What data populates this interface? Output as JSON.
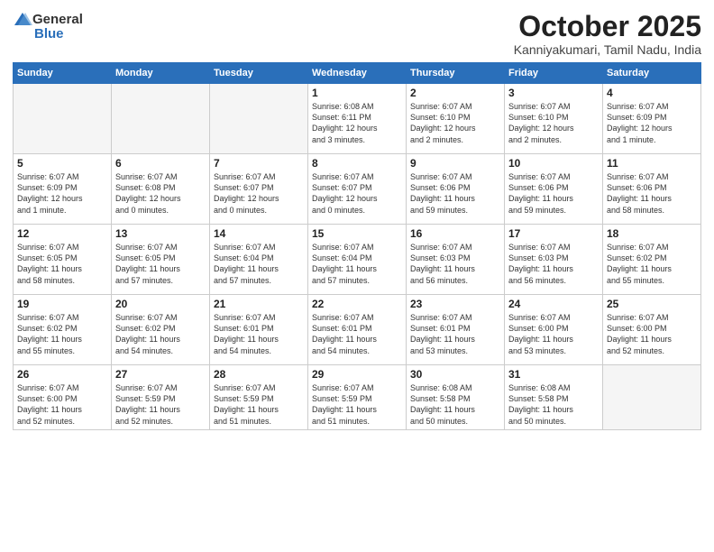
{
  "logo": {
    "general": "General",
    "blue": "Blue"
  },
  "title": "October 2025",
  "location": "Kanniyakumari, Tamil Nadu, India",
  "headers": [
    "Sunday",
    "Monday",
    "Tuesday",
    "Wednesday",
    "Thursday",
    "Friday",
    "Saturday"
  ],
  "weeks": [
    [
      {
        "day": "",
        "info": ""
      },
      {
        "day": "",
        "info": ""
      },
      {
        "day": "",
        "info": ""
      },
      {
        "day": "1",
        "info": "Sunrise: 6:08 AM\nSunset: 6:11 PM\nDaylight: 12 hours\nand 3 minutes."
      },
      {
        "day": "2",
        "info": "Sunrise: 6:07 AM\nSunset: 6:10 PM\nDaylight: 12 hours\nand 2 minutes."
      },
      {
        "day": "3",
        "info": "Sunrise: 6:07 AM\nSunset: 6:10 PM\nDaylight: 12 hours\nand 2 minutes."
      },
      {
        "day": "4",
        "info": "Sunrise: 6:07 AM\nSunset: 6:09 PM\nDaylight: 12 hours\nand 1 minute."
      }
    ],
    [
      {
        "day": "5",
        "info": "Sunrise: 6:07 AM\nSunset: 6:09 PM\nDaylight: 12 hours\nand 1 minute."
      },
      {
        "day": "6",
        "info": "Sunrise: 6:07 AM\nSunset: 6:08 PM\nDaylight: 12 hours\nand 0 minutes."
      },
      {
        "day": "7",
        "info": "Sunrise: 6:07 AM\nSunset: 6:07 PM\nDaylight: 12 hours\nand 0 minutes."
      },
      {
        "day": "8",
        "info": "Sunrise: 6:07 AM\nSunset: 6:07 PM\nDaylight: 12 hours\nand 0 minutes."
      },
      {
        "day": "9",
        "info": "Sunrise: 6:07 AM\nSunset: 6:06 PM\nDaylight: 11 hours\nand 59 minutes."
      },
      {
        "day": "10",
        "info": "Sunrise: 6:07 AM\nSunset: 6:06 PM\nDaylight: 11 hours\nand 59 minutes."
      },
      {
        "day": "11",
        "info": "Sunrise: 6:07 AM\nSunset: 6:06 PM\nDaylight: 11 hours\nand 58 minutes."
      }
    ],
    [
      {
        "day": "12",
        "info": "Sunrise: 6:07 AM\nSunset: 6:05 PM\nDaylight: 11 hours\nand 58 minutes."
      },
      {
        "day": "13",
        "info": "Sunrise: 6:07 AM\nSunset: 6:05 PM\nDaylight: 11 hours\nand 57 minutes."
      },
      {
        "day": "14",
        "info": "Sunrise: 6:07 AM\nSunset: 6:04 PM\nDaylight: 11 hours\nand 57 minutes."
      },
      {
        "day": "15",
        "info": "Sunrise: 6:07 AM\nSunset: 6:04 PM\nDaylight: 11 hours\nand 57 minutes."
      },
      {
        "day": "16",
        "info": "Sunrise: 6:07 AM\nSunset: 6:03 PM\nDaylight: 11 hours\nand 56 minutes."
      },
      {
        "day": "17",
        "info": "Sunrise: 6:07 AM\nSunset: 6:03 PM\nDaylight: 11 hours\nand 56 minutes."
      },
      {
        "day": "18",
        "info": "Sunrise: 6:07 AM\nSunset: 6:02 PM\nDaylight: 11 hours\nand 55 minutes."
      }
    ],
    [
      {
        "day": "19",
        "info": "Sunrise: 6:07 AM\nSunset: 6:02 PM\nDaylight: 11 hours\nand 55 minutes."
      },
      {
        "day": "20",
        "info": "Sunrise: 6:07 AM\nSunset: 6:02 PM\nDaylight: 11 hours\nand 54 minutes."
      },
      {
        "day": "21",
        "info": "Sunrise: 6:07 AM\nSunset: 6:01 PM\nDaylight: 11 hours\nand 54 minutes."
      },
      {
        "day": "22",
        "info": "Sunrise: 6:07 AM\nSunset: 6:01 PM\nDaylight: 11 hours\nand 54 minutes."
      },
      {
        "day": "23",
        "info": "Sunrise: 6:07 AM\nSunset: 6:01 PM\nDaylight: 11 hours\nand 53 minutes."
      },
      {
        "day": "24",
        "info": "Sunrise: 6:07 AM\nSunset: 6:00 PM\nDaylight: 11 hours\nand 53 minutes."
      },
      {
        "day": "25",
        "info": "Sunrise: 6:07 AM\nSunset: 6:00 PM\nDaylight: 11 hours\nand 52 minutes."
      }
    ],
    [
      {
        "day": "26",
        "info": "Sunrise: 6:07 AM\nSunset: 6:00 PM\nDaylight: 11 hours\nand 52 minutes."
      },
      {
        "day": "27",
        "info": "Sunrise: 6:07 AM\nSunset: 5:59 PM\nDaylight: 11 hours\nand 52 minutes."
      },
      {
        "day": "28",
        "info": "Sunrise: 6:07 AM\nSunset: 5:59 PM\nDaylight: 11 hours\nand 51 minutes."
      },
      {
        "day": "29",
        "info": "Sunrise: 6:07 AM\nSunset: 5:59 PM\nDaylight: 11 hours\nand 51 minutes."
      },
      {
        "day": "30",
        "info": "Sunrise: 6:08 AM\nSunset: 5:58 PM\nDaylight: 11 hours\nand 50 minutes."
      },
      {
        "day": "31",
        "info": "Sunrise: 6:08 AM\nSunset: 5:58 PM\nDaylight: 11 hours\nand 50 minutes."
      },
      {
        "day": "",
        "info": ""
      }
    ]
  ]
}
